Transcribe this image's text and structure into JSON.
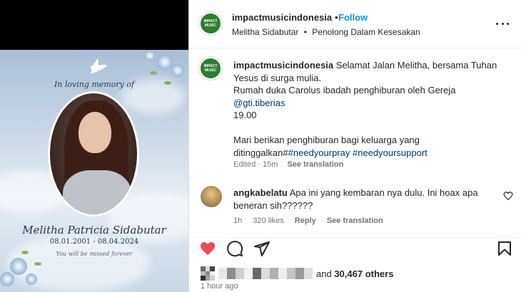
{
  "post": {
    "username": "impactmusicindonesia",
    "follow_label": "Follow",
    "separator": "•",
    "avatar_text": "IMPACT MUSIC",
    "audio_artist": "Melitha Sidabutar",
    "audio_title": "Penolong Dalam Kesesakan"
  },
  "media": {
    "memory_text": "In loving memory of",
    "name": "Melitha Patricia Sidabutar",
    "dates": "08.01.2001 - 08.04.2024",
    "missed_text": "You will be missed forever"
  },
  "caption": {
    "username": "impactmusicindonesia",
    "line1": " Selamat Jalan Melitha, bersama Tuhan Yesus di surga mulia.",
    "line2": "Rumah duka Carolus ibadah penghiburan oleh Gereja",
    "mention": "@gti.tiberias",
    "line3": "19.00",
    "line4": "Mari berikan penghiburan bagi keluarga yang ditinggalkan#",
    "hashtag1": "#needyourpray",
    "hashtag2": "#needyoursupport",
    "edited": "Edited",
    "age": "15m",
    "see_translation": "See translation"
  },
  "comment": {
    "username": "angkabelatu",
    "text": " Apa ini yang kembaran nya dulu. Ini hoax apa beneran sih??????",
    "age": "1h",
    "likes": "320 likes",
    "reply": "Reply",
    "see_translation": "See translation"
  },
  "likes": {
    "suffix": " and ",
    "count": "30,467 others"
  },
  "timestamp": "1 hour ago",
  "icons": [
    "heart-filled-icon",
    "comment-icon",
    "share-icon",
    "bookmark-icon",
    "more-icon",
    "heart-outline-icon"
  ],
  "colors": {
    "accent": "#0095f6",
    "like": "#ed4956",
    "text": "#262626",
    "muted": "#737373"
  }
}
